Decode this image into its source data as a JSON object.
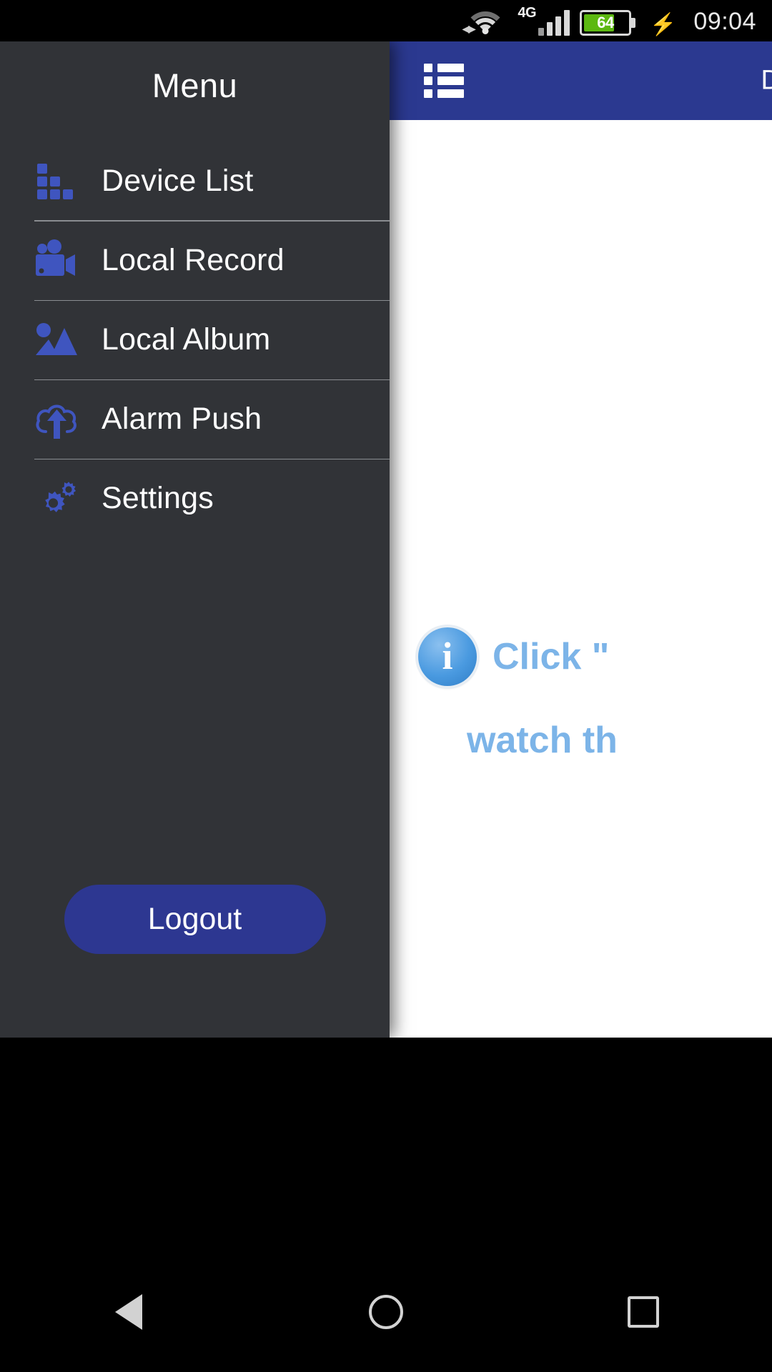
{
  "status_bar": {
    "wifi_icon": "wifi-icon",
    "network_type": "4G",
    "signal_icon": "signal-bars-icon",
    "battery_level": "64",
    "battery_icon": "battery-icon",
    "charging_icon": "charging-bolt-icon",
    "time": "09:04"
  },
  "drawer": {
    "title": "Menu",
    "items": [
      {
        "label": "Device List",
        "icon": "device-grid-icon"
      },
      {
        "label": "Local Record",
        "icon": "video-camera-icon"
      },
      {
        "label": "Local Album",
        "icon": "photo-image-icon"
      },
      {
        "label": "Alarm Push",
        "icon": "cloud-upload-icon"
      },
      {
        "label": "Settings",
        "icon": "gears-icon"
      }
    ],
    "logout_label": "Logout"
  },
  "app_panel": {
    "menu_icon": "list-menu-icon",
    "title": "D",
    "hint_line1": "Click \"",
    "hint_line2": "watch th"
  },
  "nav_bar": {
    "back_icon": "back-triangle-icon",
    "home_icon": "home-circle-icon",
    "recents_icon": "recents-square-icon"
  },
  "colors": {
    "accent_blue": "#2b3990",
    "icon_blue": "#3f55bf",
    "drawer_bg": "#313337",
    "battery_green": "#5cb811",
    "hint_blue": "#7cb4e8"
  }
}
